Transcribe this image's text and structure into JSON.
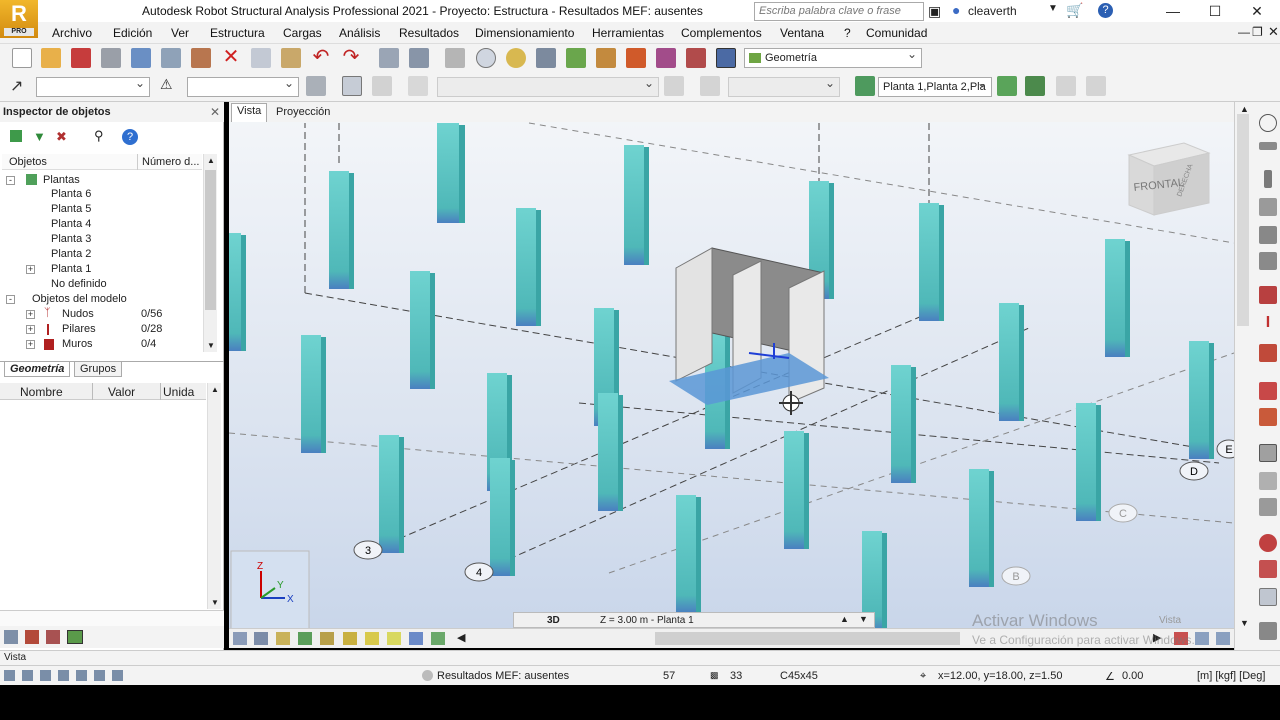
{
  "app": {
    "logo_letter": "R",
    "logo_sub": "PRO",
    "title": "Autodesk Robot Structural Analysis Professional 2021 - Proyecto: Estructura - Resultados MEF: ausentes",
    "search_placeholder": "Escriba palabra clave o frase",
    "user": "cleaverth",
    "window_controls": {
      "minimize": "—",
      "maximize": "☐",
      "close": "✕"
    }
  },
  "menu": [
    "Archivo",
    "Edición",
    "Ver",
    "Estructura",
    "Cargas",
    "Análisis",
    "Resultados",
    "Dimensionamiento",
    "Herramientas",
    "Complementos",
    "Ventana",
    "?",
    "Comunidad"
  ],
  "toolbar": {
    "layout_combo": "Geometría",
    "stories_combo": "Planta 1,Planta 2,Pla",
    "combo_a": "",
    "combo_b": "",
    "combo_c": "",
    "combo_d": ""
  },
  "inspector": {
    "title": "Inspector de objetos",
    "columns": [
      "Objetos",
      "Número d..."
    ],
    "tree": {
      "root": "Plantas",
      "stories": [
        "Planta 6",
        "Planta 5",
        "Planta 4",
        "Planta 3",
        "Planta 2",
        "Planta 1",
        "No definido"
      ],
      "model_objects_label": "Objetos del modelo",
      "model_objects": [
        {
          "name": "Nudos",
          "count": "0/56"
        },
        {
          "name": "Pilares",
          "count": "0/28"
        },
        {
          "name": "Muros",
          "count": "0/4"
        }
      ]
    },
    "tabs": [
      "Geometría",
      "Grupos"
    ],
    "props_columns": [
      "Nombre",
      "Valor",
      "Unida"
    ]
  },
  "view": {
    "tabs": [
      "Vista",
      "Proyección"
    ],
    "viewcube_front": "FRONTAL",
    "viewcube_right": "DERECHA",
    "axis_labels": [
      "3",
      "4",
      "B",
      "C",
      "D",
      "E"
    ],
    "view_mode": "3D",
    "level": "Z = 3.00 m - Planta 1",
    "bottom_label": "Vista"
  },
  "watermark": {
    "line1": "Activar Windows",
    "line2": "Ve a Configuración para activar Windows."
  },
  "status": {
    "view_label": "Vista",
    "results": "Resultados MEF: ausentes",
    "count_a": "57",
    "count_b": "33",
    "section": "C45x45",
    "coords": "x=12.00, y=18.00, z=1.50",
    "angle": "0.00",
    "units": "[m] [kgf] [Deg]"
  },
  "colors": {
    "column_top": "#5dc8c6",
    "column_bottom": "#4a7fc0",
    "wall": "#e6e6e6",
    "menu_bg": "#f3f3f3"
  }
}
